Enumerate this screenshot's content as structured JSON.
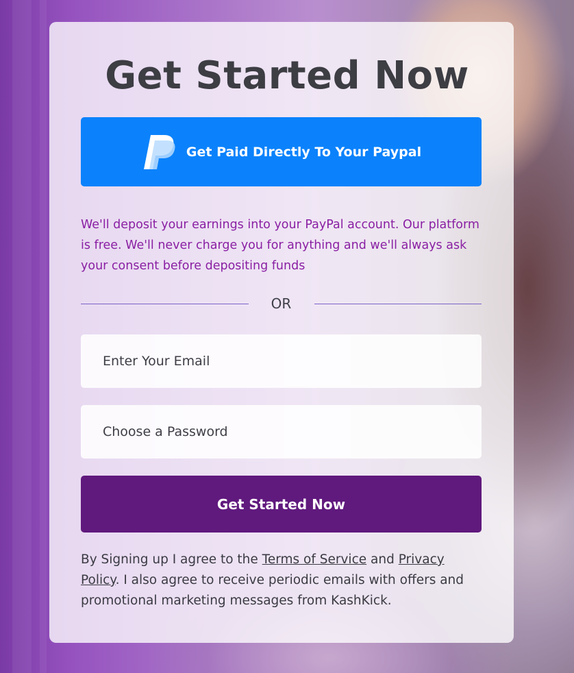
{
  "page": {
    "title": "Get Started Now",
    "paypal_button_label": "Get Paid Directly To Your Paypal",
    "paypal_icon": "paypal-logo-icon",
    "description": "We'll deposit your earnings into your PayPal account. Our platform is free. We'll never charge you for anything and we'll always ask your consent before depositing funds",
    "divider_text": "OR",
    "email_placeholder": "Enter Your Email",
    "password_placeholder": "Choose a Password",
    "submit_label": "Get Started Now",
    "terms": {
      "prefix": "By Signing up I agree to the ",
      "terms_link": "Terms of Service",
      "and": " and ",
      "privacy_link": "Privacy Policy",
      "suffix": ". I also agree to receive periodic emails with offers and promotional marketing messages from KashKick."
    }
  },
  "colors": {
    "paypal_blue": "#0b82fb",
    "submit_purple": "#60197d",
    "description_purple": "#8a1fa3",
    "title_gray": "#3d3d44"
  }
}
